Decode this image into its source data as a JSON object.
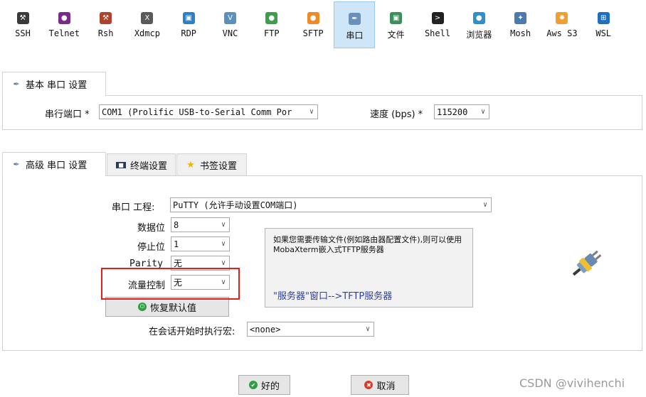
{
  "toolbar": {
    "items": [
      {
        "label": "SSH",
        "icon": "ssh-icon",
        "color": "#3a3a3a",
        "glyph": "⚒"
      },
      {
        "label": "Telnet",
        "icon": "telnet-icon",
        "color": "#7b2a8a",
        "glyph": "●"
      },
      {
        "label": "Rsh",
        "icon": "rsh-icon",
        "color": "#b0412a",
        "glyph": "⚒"
      },
      {
        "label": "Xdmcp",
        "icon": "xdmcp-icon",
        "color": "#5a5a5a",
        "glyph": "X"
      },
      {
        "label": "RDP",
        "icon": "rdp-icon",
        "color": "#2f7fc8",
        "glyph": "▣"
      },
      {
        "label": "VNC",
        "icon": "vnc-icon",
        "color": "#5a8fc0",
        "glyph": "V"
      },
      {
        "label": "FTP",
        "icon": "ftp-icon",
        "color": "#3aa04a",
        "glyph": "●"
      },
      {
        "label": "SFTP",
        "icon": "sftp-icon",
        "color": "#f08a24",
        "glyph": "●"
      },
      {
        "label": "串口",
        "icon": "serial-plug-icon",
        "color": "#6a8fb8",
        "glyph": "✒"
      },
      {
        "label": "文件",
        "icon": "file-icon",
        "color": "#3d8f5a",
        "glyph": "▣"
      },
      {
        "label": "Shell",
        "icon": "shell-icon",
        "color": "#222222",
        "glyph": ">"
      },
      {
        "label": "浏览器",
        "icon": "browser-globe-icon",
        "color": "#2e8fd0",
        "glyph": "●"
      },
      {
        "label": "Mosh",
        "icon": "mosh-satellite-icon",
        "color": "#4a7ab0",
        "glyph": "✦"
      },
      {
        "label": "Aws S3",
        "icon": "aws-s3-icon",
        "color": "#f0a030",
        "glyph": "✹"
      },
      {
        "label": "WSL",
        "icon": "wsl-windows-icon",
        "color": "#1f6fc0",
        "glyph": "⊞"
      }
    ],
    "active_index": 8
  },
  "basic": {
    "tab_label": "基本 串口 设置",
    "port_label": "串行端口 *",
    "port_value": "COM1  (Prolific USB-to-Serial Comm Por",
    "speed_label": "速度 (bps) *",
    "speed_value": "115200"
  },
  "advanced": {
    "tabs": [
      "高级 串口 设置",
      "终端设置",
      "书签设置"
    ],
    "engine_label": "串口 工程:",
    "engine_value": "PuTTY  (允许手动设置COM端口)",
    "databits_label": "数据位",
    "databits_value": "8",
    "stopbits_label": "停止位",
    "stopbits_value": "1",
    "parity_label": "Parity",
    "parity_value": "无",
    "flow_label": "流量控制",
    "flow_value": "无",
    "restore_label": "恢复默认值",
    "info_text": "如果您需要传输文件(例如路由器配置文件),则可以使用MobaXterm嵌入式TFTP服务器",
    "info_link": "\"服务器\"窗口-->TFTP服务器",
    "macro_label": "在会话开始时执行宏:",
    "macro_value": "<none>"
  },
  "footer": {
    "ok_label": "好的",
    "cancel_label": "取消"
  },
  "watermark": "CSDN @vivihenchi",
  "colors": {
    "accent": "#cfe6f8",
    "highlight": "#e0201c",
    "link": "#2b3fa8"
  }
}
